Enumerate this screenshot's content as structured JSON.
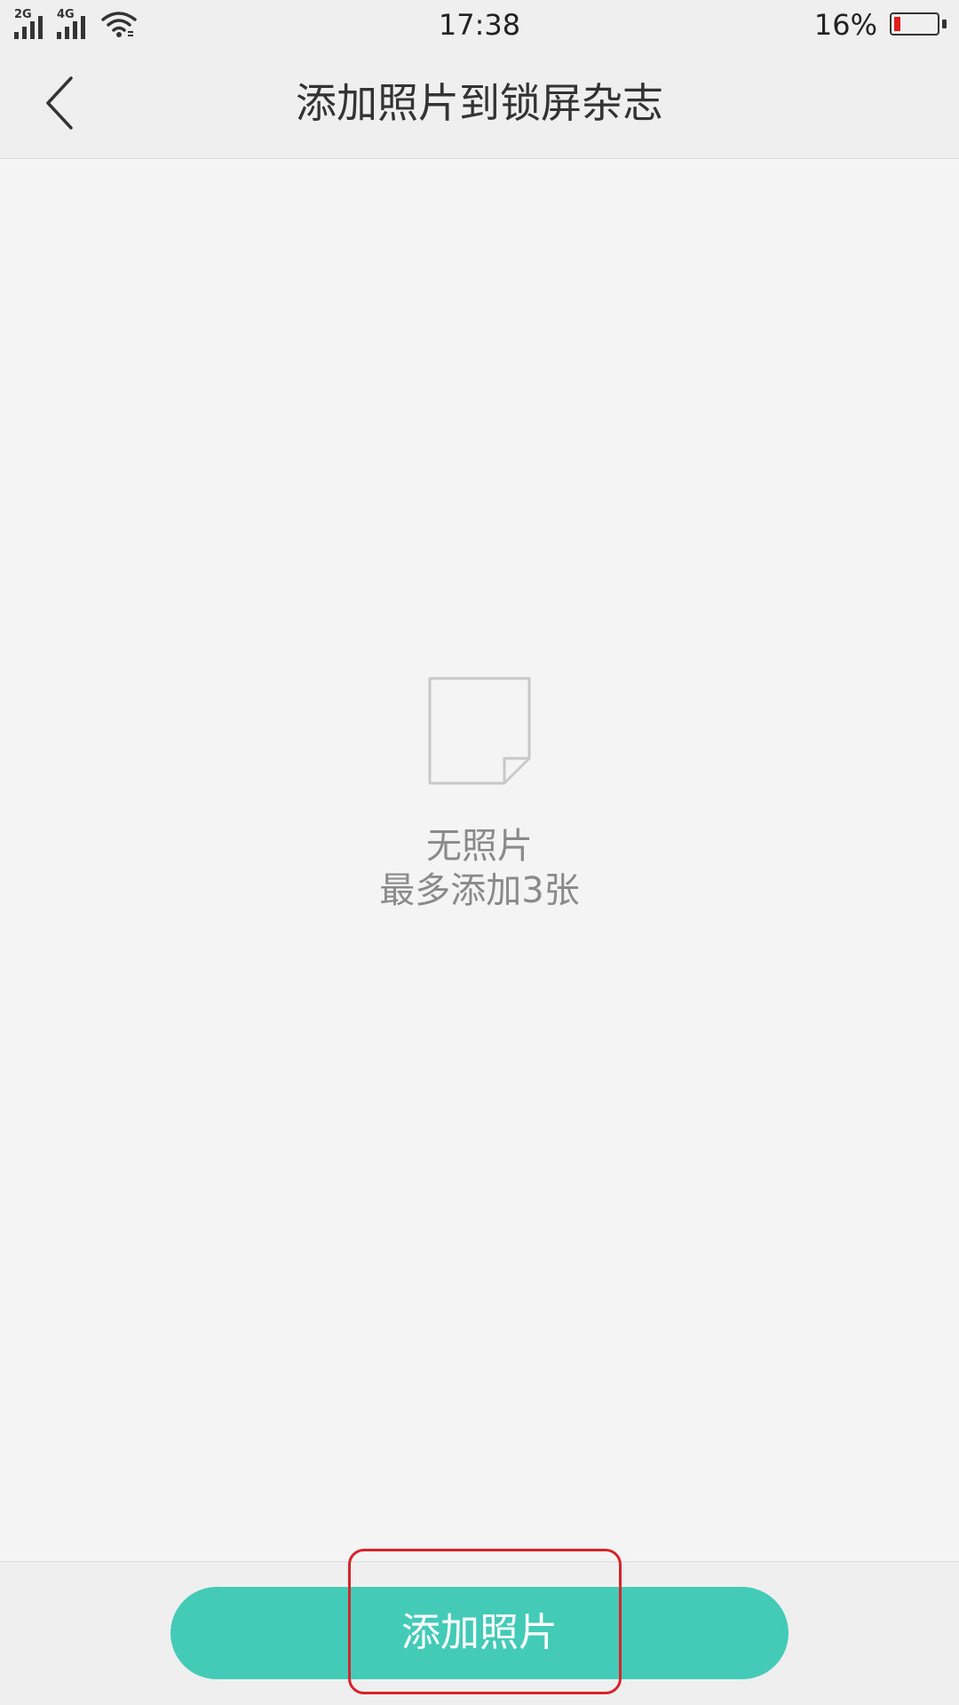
{
  "status_bar": {
    "sim1_tag": "2G",
    "sim2_tag": "4G",
    "time": "17:38",
    "battery_percent": "16%",
    "battery_level": 0.16,
    "battery_color": "#e11c1c"
  },
  "header": {
    "back_icon": "chevron-left-icon",
    "title": "添加照片到锁屏杂志"
  },
  "empty_state": {
    "icon": "blank-document-icon",
    "title": "无照片",
    "subtitle": "最多添加3张"
  },
  "bottom": {
    "add_button_label": "添加照片",
    "accent_color": "#43cbb8",
    "highlight_color": "#d9232b"
  }
}
